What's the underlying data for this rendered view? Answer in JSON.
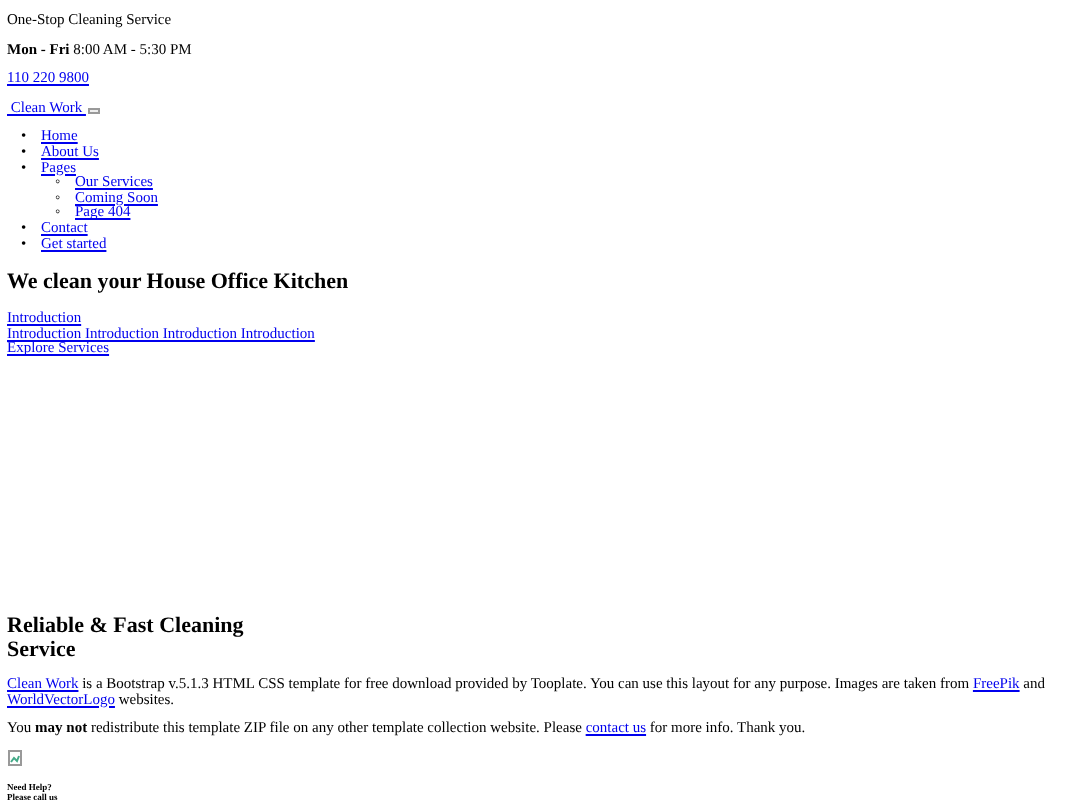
{
  "top_bar": {
    "tagline": "One-Stop Cleaning Service",
    "hours_label": "Mon - Fri",
    "hours": "8:00 AM - 5:30 PM",
    "phone": "110 220 9800"
  },
  "brand": "Clean Work",
  "nav": [
    {
      "marker": "•",
      "label": "Home"
    },
    {
      "marker": "•",
      "label": "About Us"
    },
    {
      "marker": "•",
      "label": "Pages",
      "children": [
        {
          "marker": "◦",
          "label": "Our Services"
        },
        {
          "marker": "◦",
          "label": "Coming Soon"
        },
        {
          "marker": "◦",
          "label": "Page 404"
        }
      ]
    },
    {
      "marker": "•",
      "label": "Contact"
    },
    {
      "marker": "•",
      "label": "Get started"
    }
  ],
  "hero": {
    "title": "We clean your House Office Kitchen",
    "links": [
      "Introduction",
      "Introduction Introduction Introduction Introduction",
      "Explore Services"
    ]
  },
  "about": {
    "title": "Reliable & Fast Cleaning Service",
    "paragraph_1": {
      "link_1": "Clean Work",
      "text_1": " is a Bootstrap v.5.1.3 HTML CSS template for free download provided by Tooplate. You can use this layout for any purpose. Images are taken from ",
      "link_2": "FreePik",
      "text_2": " and ",
      "link_3": "WorldVectorLogo",
      "text_3": " websites."
    },
    "paragraph_2": {
      "text_1": "You **may not** redistribute this template ZIP file on any other template collection website. Please ",
      "link": "contact us",
      "text_2": " for more info. Thank you."
    }
  },
  "help": [
    "Need Help?",
    "Please call us"
  ]
}
